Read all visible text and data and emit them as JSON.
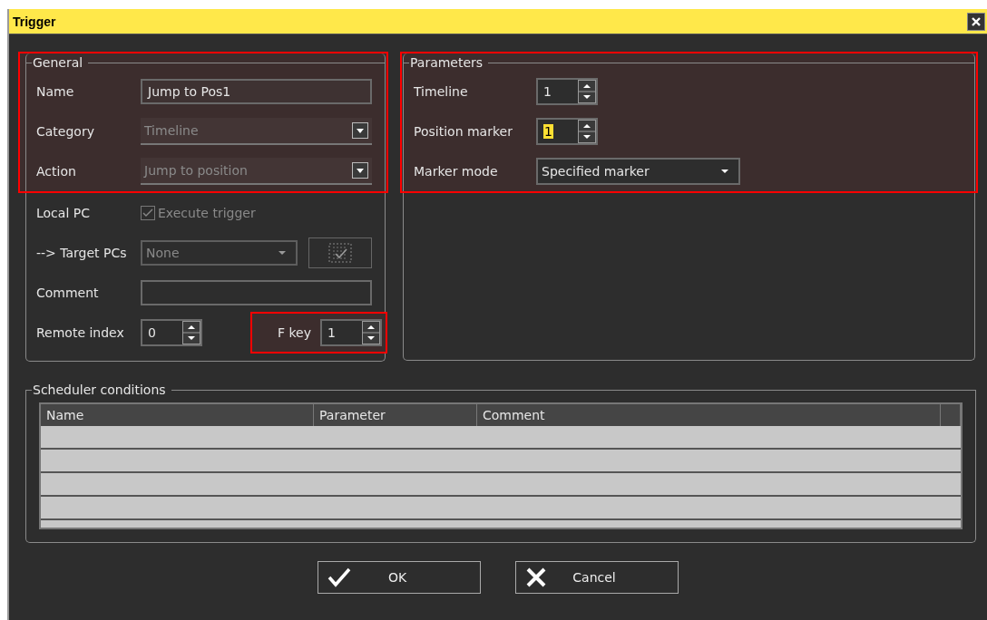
{
  "window": {
    "title": "Trigger"
  },
  "general": {
    "title": "General",
    "sections": [
      {
        "highlighted": true,
        "fields": [
          {
            "kind": "text",
            "label": "Name",
            "value": "Jump to Pos1"
          },
          {
            "kind": "dropdown",
            "label": "Category",
            "value": "Timeline",
            "disabled": true
          },
          {
            "kind": "dropdown",
            "label": "Action",
            "value": "Jump to position",
            "disabled": true
          }
        ]
      },
      {
        "highlighted": false,
        "fields": [
          {
            "kind": "checkbox",
            "label": "Local PC",
            "text": "Execute trigger",
            "checked": true,
            "disabled": true
          },
          {
            "kind": "combo_button",
            "label": "--> Target PCs",
            "value": "None",
            "disabled": true
          },
          {
            "kind": "text",
            "label": "Comment"
          },
          {
            "kind": "spin_pair",
            "label": "Remote index",
            "value": "0",
            "extra": {
              "label": "F key",
              "value": "1",
              "highlighted": true
            }
          }
        ]
      }
    ]
  },
  "parameters": {
    "title": "Parameters",
    "highlighted": true,
    "fields": [
      {
        "kind": "spin",
        "label": "Timeline",
        "value": "1",
        "text_selected": false
      },
      {
        "kind": "spin",
        "label": "Position marker",
        "value": "1",
        "text_selected": true
      },
      {
        "kind": "combo",
        "label": "Marker mode",
        "value": "Specified marker",
        "disabled": false
      }
    ]
  },
  "scheduler": {
    "title": "Scheduler conditions",
    "columns": [
      "Name",
      "Parameter",
      "Comment"
    ]
  },
  "buttons": [
    {
      "kind": "ok",
      "label": "OK"
    },
    {
      "kind": "cancel",
      "label": "Cancel"
    }
  ]
}
